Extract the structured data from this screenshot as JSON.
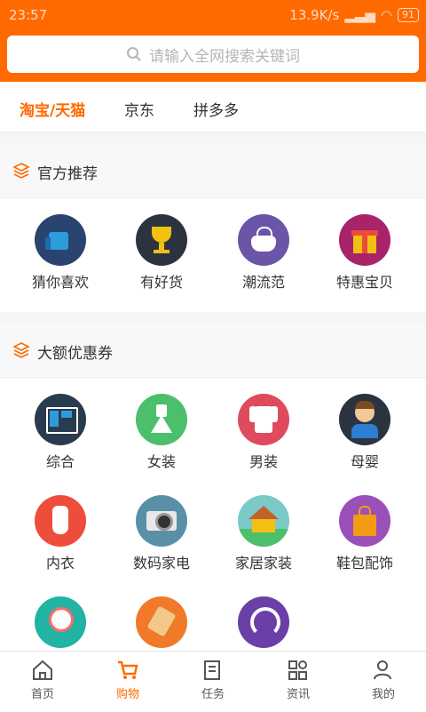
{
  "status": {
    "time": "23:57",
    "speed": "13.9K/s",
    "battery": "91"
  },
  "search": {
    "placeholder": "请输入全网搜索关键词"
  },
  "tabs": [
    {
      "label": "淘宝/天猫"
    },
    {
      "label": "京东"
    },
    {
      "label": "拼多多"
    }
  ],
  "sections": {
    "official": {
      "title": "官方推荐",
      "items": [
        {
          "label": "猜你喜欢"
        },
        {
          "label": "有好货"
        },
        {
          "label": "潮流范"
        },
        {
          "label": "特惠宝贝"
        }
      ]
    },
    "coupons": {
      "title": "大额优惠券",
      "items": [
        {
          "label": "综合"
        },
        {
          "label": "女装"
        },
        {
          "label": "男装"
        },
        {
          "label": "母婴"
        },
        {
          "label": "内衣"
        },
        {
          "label": "数码家电"
        },
        {
          "label": "家居家装"
        },
        {
          "label": "鞋包配饰"
        }
      ]
    }
  },
  "bottom_nav": [
    {
      "label": "首页"
    },
    {
      "label": "购物"
    },
    {
      "label": "任务"
    },
    {
      "label": "资讯"
    },
    {
      "label": "我的"
    }
  ],
  "colors": {
    "accent": "#ff6a00"
  }
}
